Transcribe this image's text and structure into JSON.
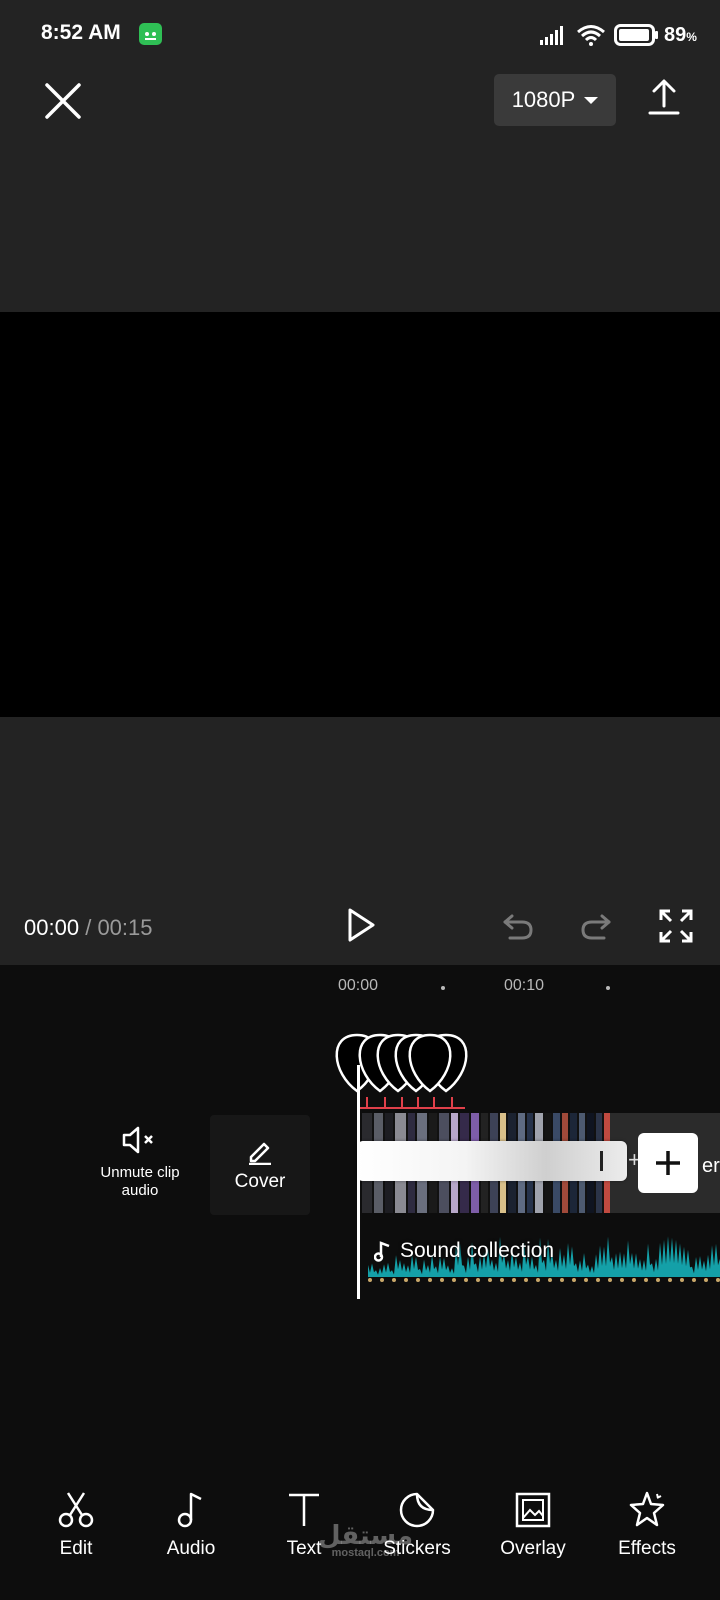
{
  "status_bar": {
    "time": "8:52 AM",
    "battery_percent": "89",
    "battery_unit": "%",
    "icons": [
      "app-notification-icon",
      "signal-icon",
      "wifi-icon",
      "battery-icon"
    ]
  },
  "toolbar": {
    "resolution": "1080P",
    "close_icon": "close-icon",
    "export_icon": "export-icon"
  },
  "playback": {
    "current_time": "00:00",
    "separator": "/",
    "total_time": "00:15"
  },
  "timeline": {
    "ruler": [
      "00:00",
      "00:10"
    ],
    "mute_label": "Unmute clip audio",
    "cover_label": "Cover",
    "audio_track_label": "Sound collection",
    "end_text": "er",
    "small_plus": "+"
  },
  "bottom_toolbar": {
    "items": [
      {
        "label": "Edit",
        "icon": "scissors-icon"
      },
      {
        "label": "Audio",
        "icon": "music-note-icon"
      },
      {
        "label": "Text",
        "icon": "text-icon"
      },
      {
        "label": "Stickers",
        "icon": "sticker-icon"
      },
      {
        "label": "Overlay",
        "icon": "overlay-icon"
      },
      {
        "label": "Effects",
        "icon": "effects-star-icon"
      }
    ]
  },
  "watermark": {
    "text": "مستقل",
    "subtext": "mostaql.com"
  },
  "colors": {
    "background": "#232323",
    "timeline_background": "#0d0d0d",
    "audio_waveform": "#14a0a8",
    "marker_red": "#e0404a"
  }
}
